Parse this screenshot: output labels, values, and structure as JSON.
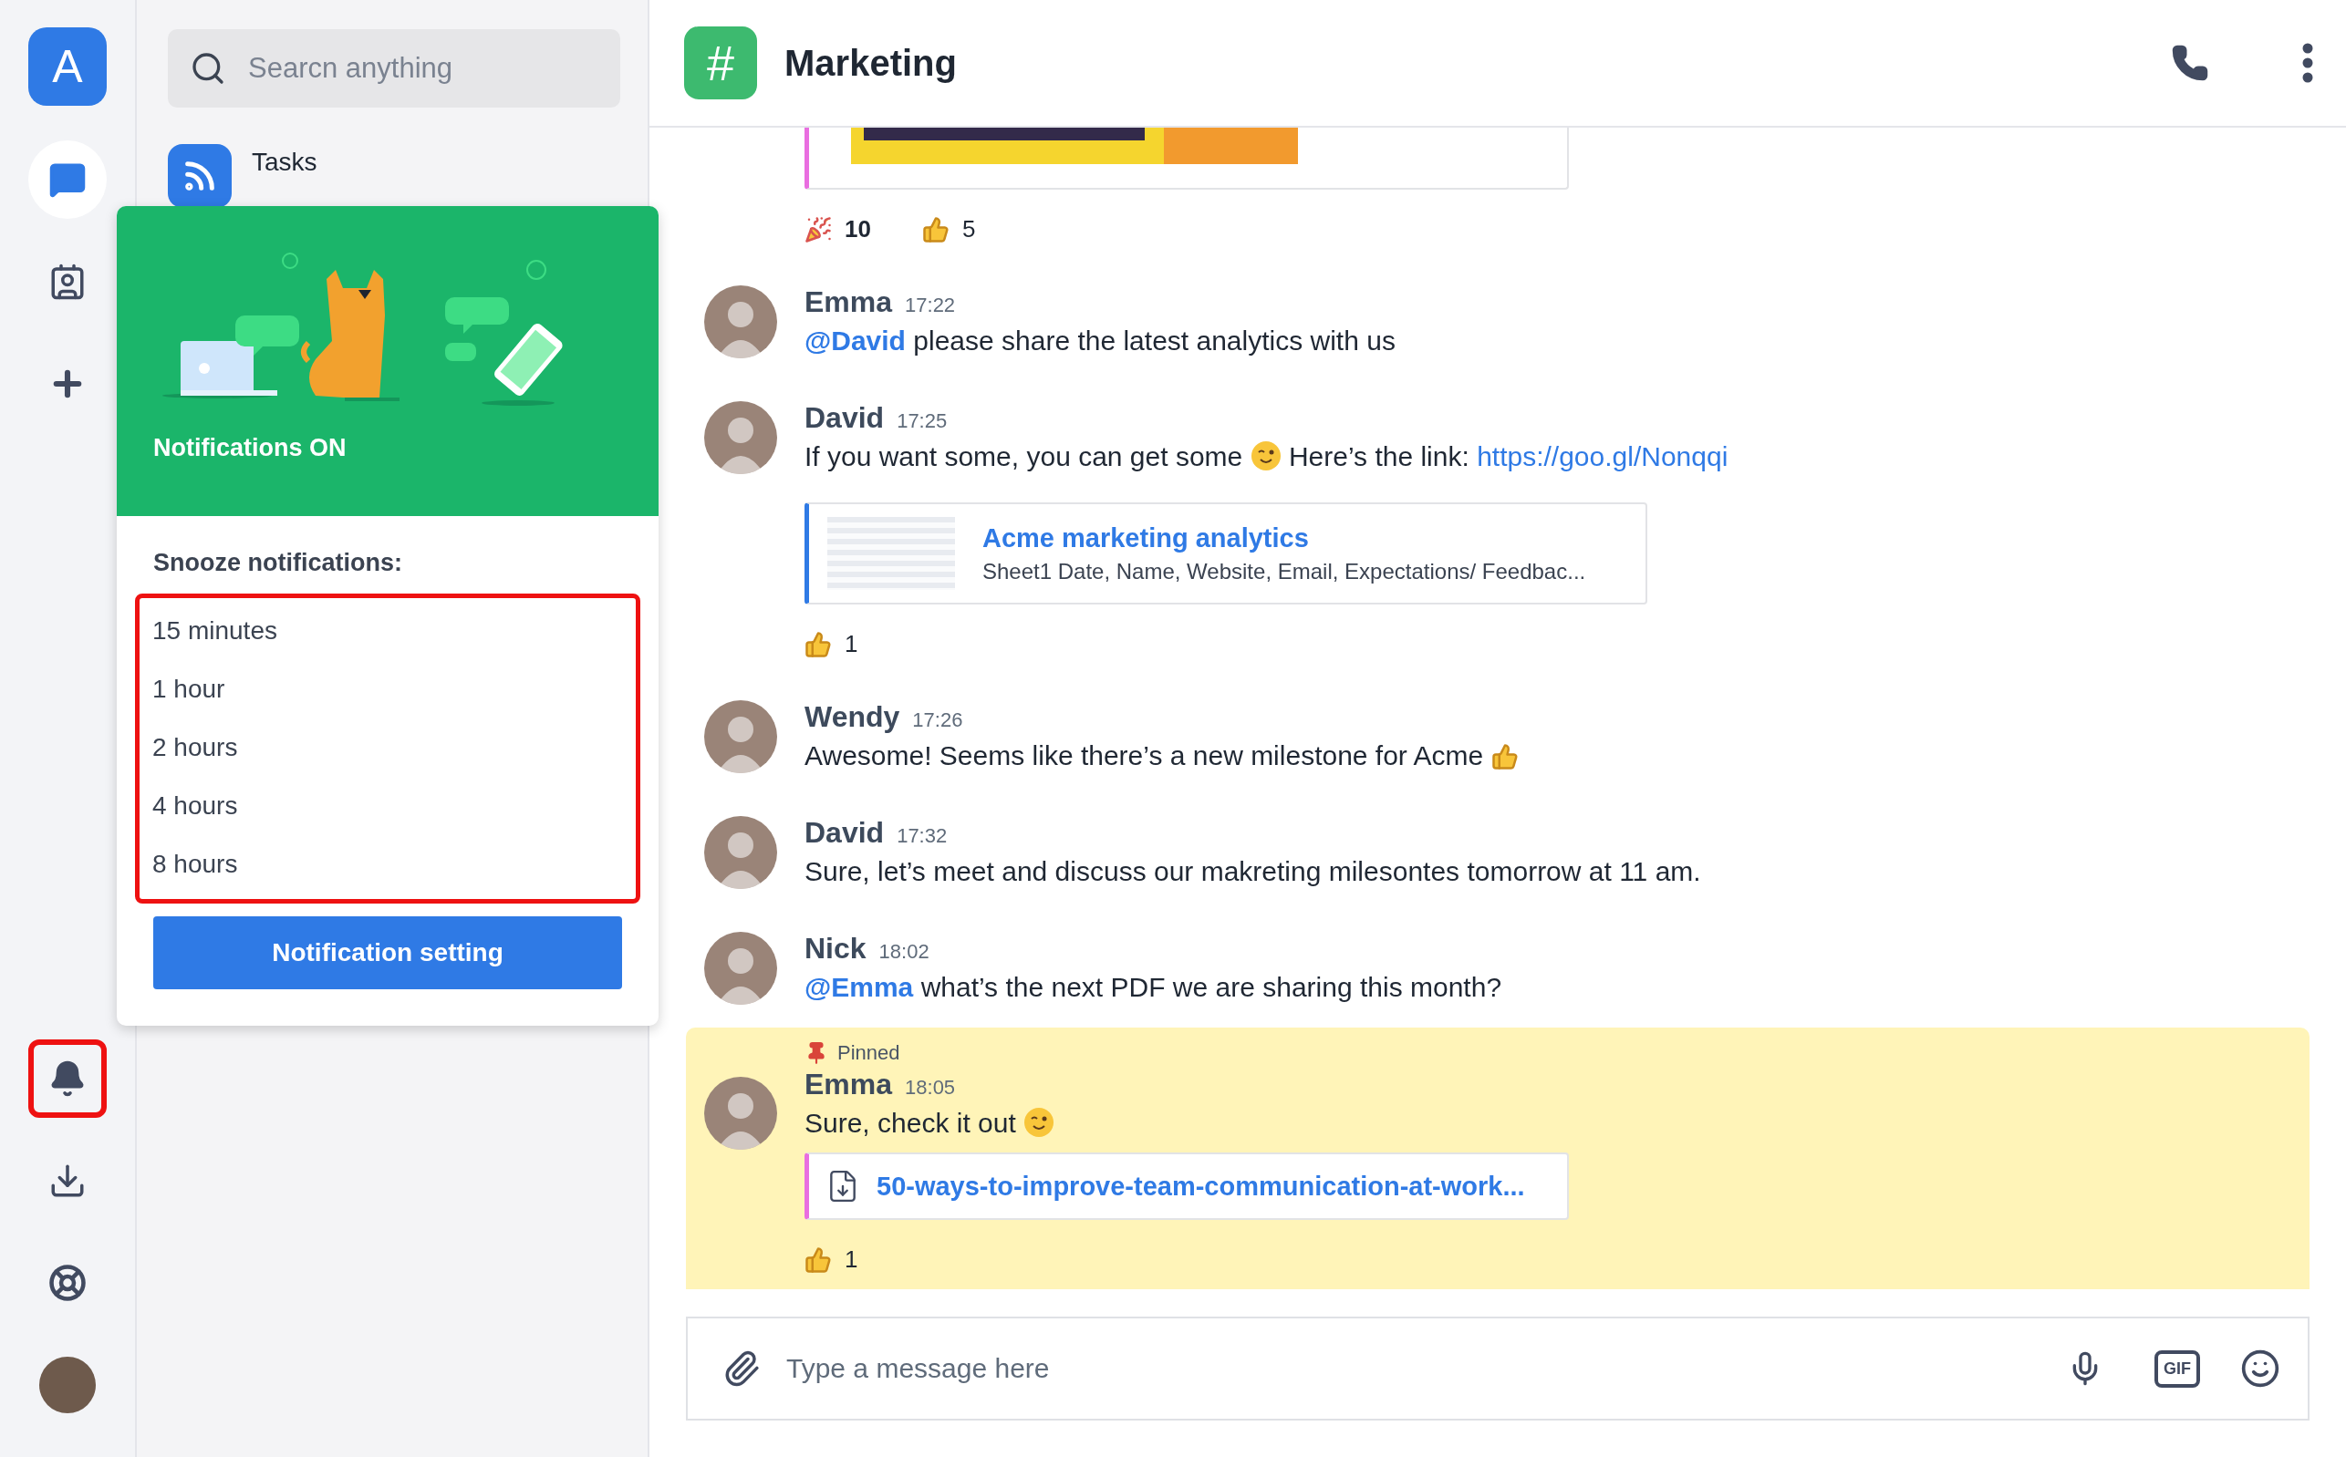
{
  "rail": {
    "logo": "A",
    "top_items": [
      {
        "kind": "chat",
        "selected": true,
        "highlighted": false
      },
      {
        "kind": "contacts",
        "selected": false,
        "highlighted": false
      },
      {
        "kind": "add",
        "selected": false,
        "highlighted": false
      }
    ],
    "bottom_items": [
      {
        "kind": "bell",
        "selected": false,
        "highlighted": true
      },
      {
        "kind": "download",
        "selected": false,
        "highlighted": false
      },
      {
        "kind": "help",
        "selected": false,
        "highlighted": false
      },
      {
        "kind": "avatar",
        "selected": false,
        "highlighted": false
      }
    ]
  },
  "sidebar": {
    "search": {
      "placeholder": "Searcn anything"
    },
    "items": [
      {
        "title": "Tasks"
      }
    ]
  },
  "popup": {
    "title": "Notifications ON",
    "snooze": {
      "heading": "Snooze notifications:",
      "highlighted": true,
      "options": [
        "15 minutes",
        "1 hour",
        "2 hours",
        "4 hours",
        "8 hours"
      ]
    },
    "button": "Notification setting"
  },
  "channel": {
    "icon": "#",
    "name": "Marketing"
  },
  "messages": [
    {
      "pinned": false,
      "attachment": {
        "kind": "image"
      },
      "reactions": [
        {
          "kind": "party",
          "count": "10",
          "selected": true
        },
        {
          "kind": "thumbs",
          "count": "5",
          "selected": false
        }
      ]
    },
    {
      "pinned": false,
      "author": "Emma",
      "time": "17:22",
      "body": [
        {
          "kind": "mention",
          "text": "@David"
        },
        {
          "kind": "text",
          "text": " please share the latest analytics with us"
        }
      ]
    },
    {
      "pinned": false,
      "author": "David",
      "time": "17:25",
      "body": [
        {
          "kind": "text",
          "text": "If you want some, you can get some "
        },
        {
          "kind": "wink"
        },
        {
          "kind": "text",
          "text": " Here’s the link: "
        },
        {
          "kind": "link",
          "text": "https://goo.gl/Nonqqi"
        }
      ],
      "attachment": {
        "kind": "preview",
        "title": "Acme marketing analytics",
        "description": "Sheet1 Date, Name, Website, Email, Expectations/ Feedbac..."
      },
      "reactions": [
        {
          "kind": "thumbs",
          "count": "1",
          "selected": false
        }
      ]
    },
    {
      "pinned": false,
      "author": "Wendy",
      "time": "17:26",
      "body": [
        {
          "kind": "text",
          "text": "Awesome! Seems like there’s a new milestone for Acme "
        },
        {
          "kind": "thumbs"
        }
      ]
    },
    {
      "pinned": false,
      "author": "David",
      "time": "17:32",
      "body": [
        {
          "kind": "text",
          "text": "Sure, let’s meet and discuss our makreting milesontes tomorrow at 11 am."
        }
      ]
    },
    {
      "pinned": false,
      "author": "Nick",
      "time": "18:02",
      "body": [
        {
          "kind": "mention",
          "text": "@Emma"
        },
        {
          "kind": "text",
          "text": " what’s the next PDF we are sharing this month?"
        }
      ]
    },
    {
      "pinned": true,
      "pin_label": "Pinned",
      "author": "Emma",
      "time": "18:05",
      "body": [
        {
          "kind": "text",
          "text": "Sure, check it out "
        },
        {
          "kind": "wink"
        }
      ],
      "attachment": {
        "kind": "file",
        "name": "50-ways-to-improve-team-communication-at-work..."
      },
      "reactions": [
        {
          "kind": "thumbs",
          "count": "1",
          "selected": false
        }
      ]
    }
  ],
  "composer": {
    "placeholder": "Type a message here",
    "gif": "GIF"
  }
}
